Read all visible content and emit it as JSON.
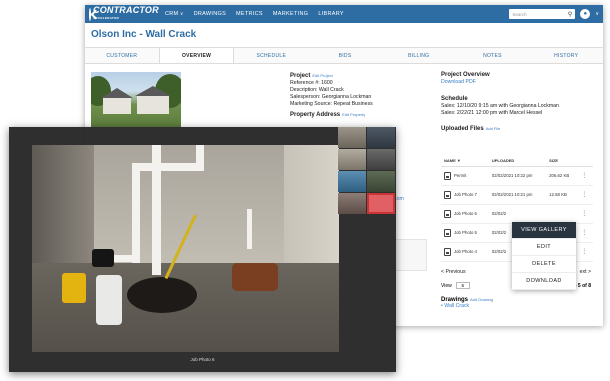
{
  "brand": {
    "name": "CONTRACTOR",
    "sub": "ACCELERATOR"
  },
  "nav": [
    {
      "label": "CRM"
    },
    {
      "label": "DRAWINGS"
    },
    {
      "label": "METRICS"
    },
    {
      "label": "MARKETING"
    },
    {
      "label": "LIBRARY"
    }
  ],
  "search": {
    "placeholder": "Search"
  },
  "page_title": "Olson Inc - Wall Crack",
  "tabs": [
    "CUSTOMER",
    "OVERVIEW",
    "SCHEDULE",
    "BIDS",
    "BILLING",
    "NOTES",
    "HISTORY"
  ],
  "project": {
    "title": "Project",
    "edit": "Edit Project",
    "reference": "Reference #: 1600",
    "description": "Description: Wall Crack",
    "salesperson": "Salesperson: Georgianna Lockman",
    "source": "Marketing Source: Repeat Business",
    "address_title": "Property Address",
    "address_edit": "Edit Property",
    "email_fragment": "com"
  },
  "overview": {
    "title": "Project Overview",
    "download": "Download PDF"
  },
  "schedule": {
    "title": "Schedule",
    "items": [
      "Sales: 12/10/20 9:15 am with Georgianna Lockman",
      "Sales: 2/22/21 12:00 pm with Marcel Hessel"
    ]
  },
  "files": {
    "title": "Uploaded Files",
    "add": "Add File",
    "headers": {
      "name": "NAME",
      "uploaded": "UPLOADED",
      "size": "SIZE"
    },
    "rows": [
      {
        "name": "Permit",
        "uploaded": "02/02/2021 10:22 pm",
        "size": "206.62 KB"
      },
      {
        "name": "Job Photo 7",
        "uploaded": "02/02/2021 10:21 pm",
        "size": "12.58 KB"
      },
      {
        "name": "Job Photo 6",
        "uploaded": "02/02/2",
        "size": ""
      },
      {
        "name": "Job Photo 5",
        "uploaded": "02/02/2",
        "size": ""
      },
      {
        "name": "Job Photo 4",
        "uploaded": "02/02/2",
        "size": ""
      }
    ]
  },
  "pagination": {
    "prev": "< Previous",
    "next": "ext >",
    "view_label": "View",
    "view_value": "5",
    "count": "1 - 5 of 8"
  },
  "drawings": {
    "title": "Drawings",
    "add": "Add Drawing",
    "items": [
      "Wall Crack"
    ]
  },
  "context_menu": [
    "VIEW GALLERY",
    "EDIT",
    "DELETE",
    "DOWNLOAD"
  ],
  "lightbox": {
    "caption": "Job Photo 6"
  },
  "colors": {
    "brand_blue": "#2d6da3",
    "link_blue": "#3b7ec6",
    "menu_active": "#2a3340"
  }
}
